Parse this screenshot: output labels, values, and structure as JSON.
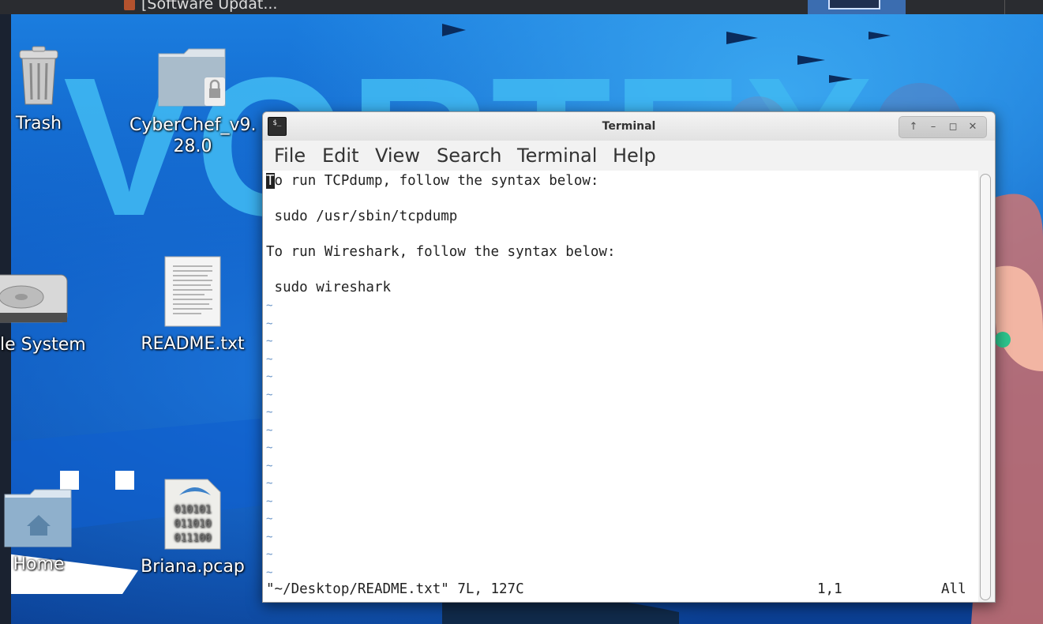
{
  "taskbar": {
    "task_label": "[Software Updat..."
  },
  "desktop": {
    "icons": [
      {
        "label": "Trash",
        "icon": "trash-icon"
      },
      {
        "label": "CyberChef_v9.",
        "label2": "28.0",
        "icon": "locked-folder-icon"
      },
      {
        "label": "le System",
        "icon": "hard-drive-icon"
      },
      {
        "label": "README.txt",
        "icon": "text-file-icon"
      },
      {
        "label": "Home",
        "icon": "home-folder-icon"
      },
      {
        "label": "Briana.pcap",
        "icon": "binary-file-icon",
        "file_text": [
          "010101",
          "011010",
          "011100"
        ]
      }
    ],
    "wallpaper_text": "VORTEX"
  },
  "terminal": {
    "title": "Terminal",
    "menu": [
      "File",
      "Edit",
      "View",
      "Search",
      "Terminal",
      "Help"
    ],
    "lines": [
      "To run TCPdump, follow the syntax below:",
      "",
      " sudo /usr/sbin/tcpdump",
      "",
      "To run Wireshark, follow the syntax below:",
      "",
      " sudo wireshark"
    ],
    "cursor_char": "T",
    "first_line_rest": "o run TCPdump, follow the syntax below:",
    "tilde": "~",
    "status_file": "\"~/Desktop/README.txt\" 7L, 127C",
    "status_pos": "1,1",
    "status_scroll": "All"
  },
  "colors": {
    "wallpaper": "#0a56bf",
    "terminal_bg": "#ffffff",
    "tilde": "#6a95c8"
  }
}
